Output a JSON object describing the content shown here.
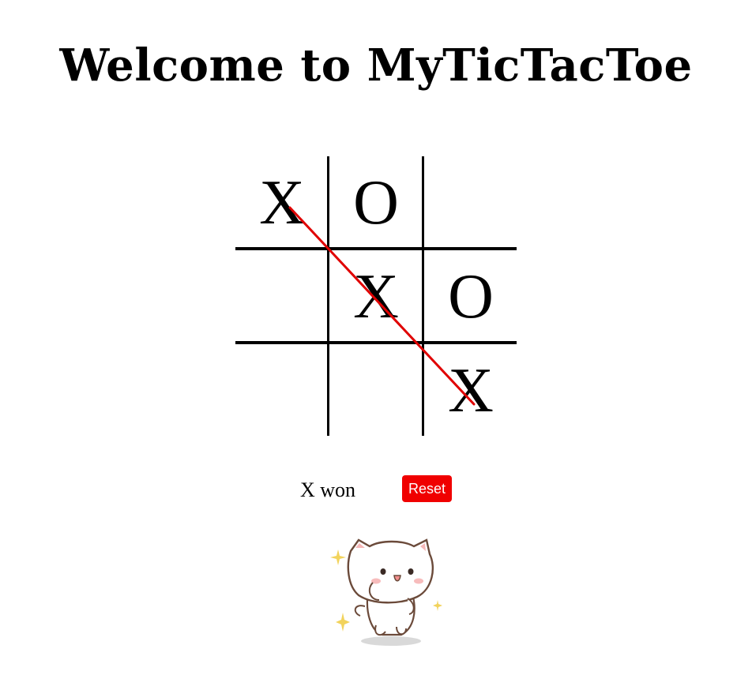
{
  "header": {
    "title": "Welcome to MyTicTacToe"
  },
  "board": {
    "cells": [
      "X",
      "O",
      "",
      "",
      "X",
      "O",
      "",
      "",
      "X"
    ],
    "winning_line": [
      0,
      4,
      8
    ],
    "line_color": "#e00000",
    "grid_color": "#000000"
  },
  "status": {
    "text": "X won"
  },
  "controls": {
    "reset_label": "Reset",
    "reset_color": "#f00000"
  },
  "decoration": {
    "mascot": "cat-sticker-icon"
  }
}
